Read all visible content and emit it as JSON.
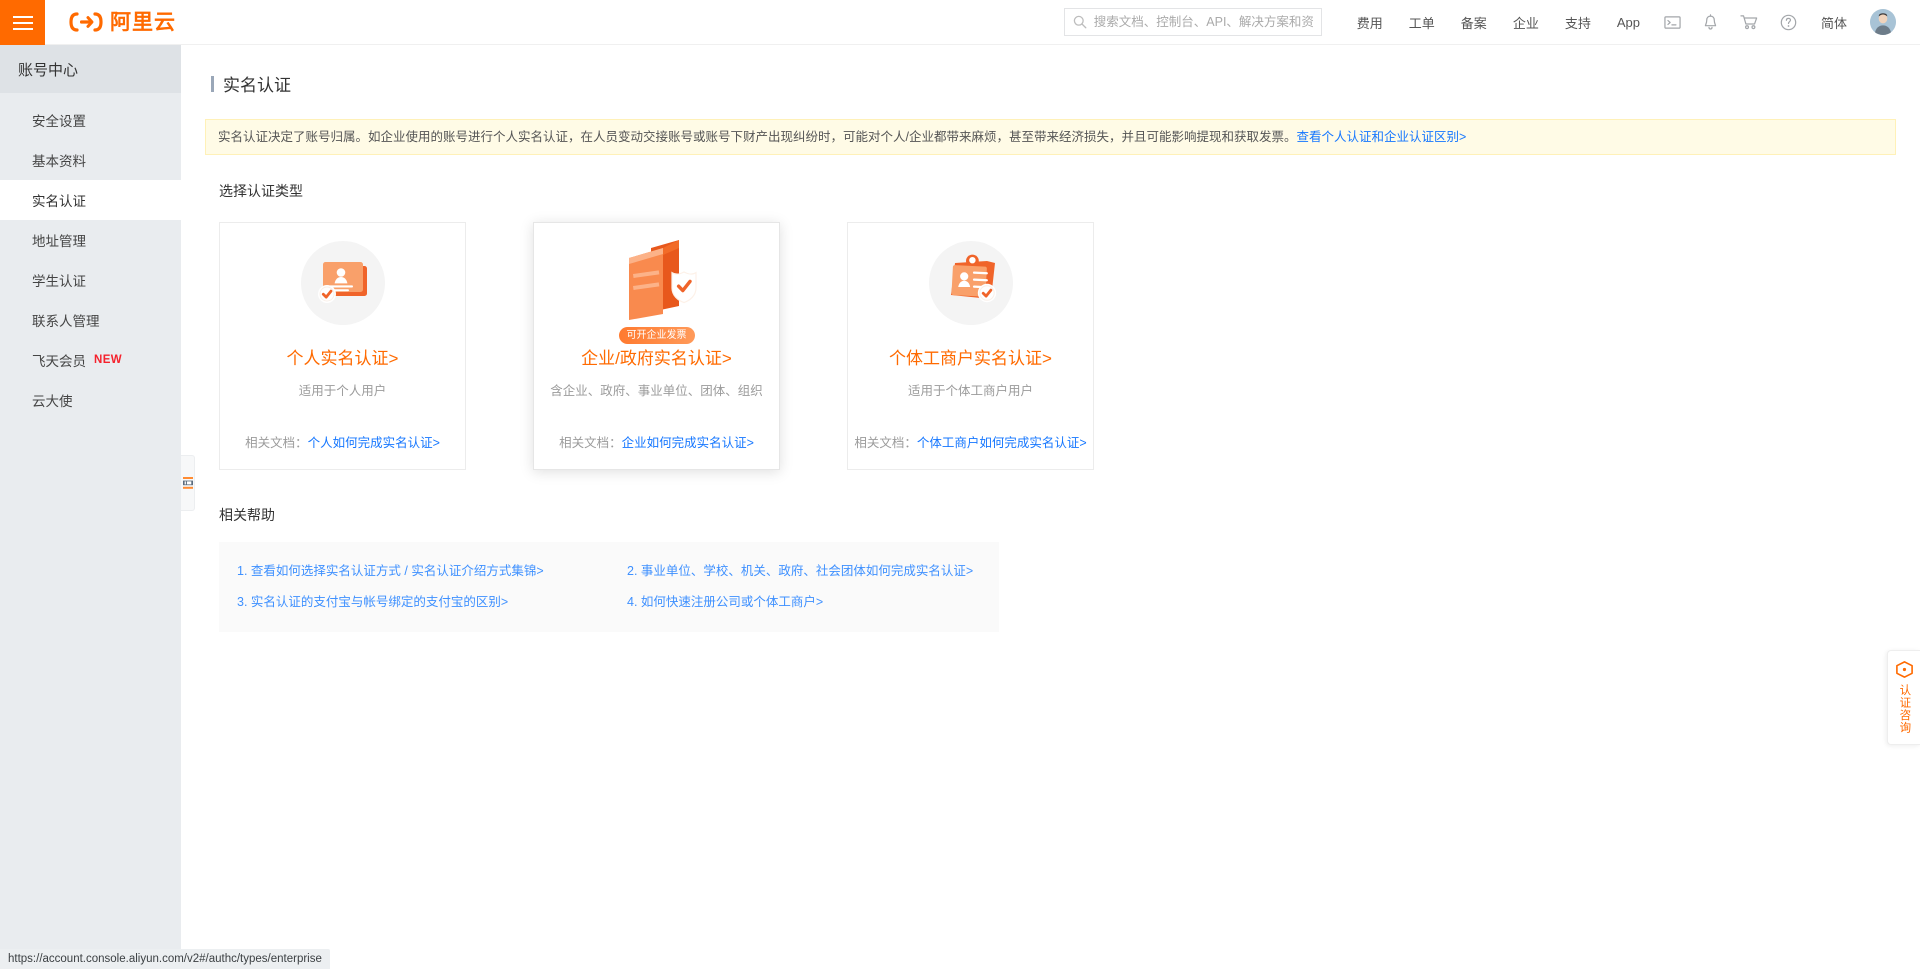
{
  "colors": {
    "brand_orange": "#ff6a00",
    "link_blue": "#1677ff",
    "help_blue": "#3e90ff",
    "sidebar_bg": "#e9ecef",
    "notice_bg": "#fffbe6",
    "notice_border": "#fff1b8",
    "badge_red": "#f5222d"
  },
  "topbar": {
    "menu_icon": "hamburger-icon",
    "logo_text": "阿里云",
    "logo_icon": "aliyun-logo-icon",
    "search": {
      "icon": "search-icon",
      "value": "",
      "placeholder": "搜索文档、控制台、API、解决方案和资"
    },
    "nav_items": [
      {
        "label": "费用"
      },
      {
        "label": "工单"
      },
      {
        "label": "备案"
      },
      {
        "label": "企业"
      },
      {
        "label": "支持"
      },
      {
        "label": "App"
      }
    ],
    "icons": [
      {
        "name": "terminal-icon"
      },
      {
        "name": "bell-icon"
      },
      {
        "name": "cart-icon"
      },
      {
        "name": "help-circle-icon"
      }
    ],
    "language_label": "简体",
    "avatar_name": "user-avatar"
  },
  "sidebar": {
    "title": "账号中心",
    "items": [
      {
        "label": "安全设置",
        "active": false,
        "badge": ""
      },
      {
        "label": "基本资料",
        "active": false,
        "badge": ""
      },
      {
        "label": "实名认证",
        "active": true,
        "badge": ""
      },
      {
        "label": "地址管理",
        "active": false,
        "badge": ""
      },
      {
        "label": "学生认证",
        "active": false,
        "badge": ""
      },
      {
        "label": "联系人管理",
        "active": false,
        "badge": ""
      },
      {
        "label": "飞天会员",
        "active": false,
        "badge": "NEW"
      },
      {
        "label": "云大使",
        "active": false,
        "badge": ""
      }
    ],
    "collapse_handle_icon": "collapse-sidebar-icon"
  },
  "main": {
    "page_title": "实名认证",
    "notice": {
      "text": "实名认证决定了账号归属。如企业使用的账号进行个人实名认证，在人员变动交接账号或账号下财产出现纠纷时，可能对个人/企业都带来麻烦，甚至带来经济损失，并且可能影响提现和获取发票。",
      "link": "查看个人认证和企业认证区别>"
    },
    "section_label": "选择认证类型",
    "cards": [
      {
        "art": "personal-id-cards-icon",
        "badge": "",
        "title": "个人实名认证>",
        "subtitle": "适用于个人用户",
        "doc_prefix": "相关文档：",
        "doc_link": "个人如何完成实名认证>",
        "raised": false
      },
      {
        "art": "enterprise-building-shield-icon",
        "badge": "可开企业发票",
        "title": "企业/政府实名认证>",
        "subtitle": "含企业、政府、事业单位、团体、组织",
        "doc_prefix": "相关文档：",
        "doc_link": "企业如何完成实名认证>",
        "raised": true
      },
      {
        "art": "business-license-badge-icon",
        "badge": "",
        "title": "个体工商户实名认证>",
        "subtitle": "适用于个体工商户用户",
        "doc_prefix": "相关文档：",
        "doc_link": "个体工商户如何完成实名认证>",
        "raised": false
      }
    ],
    "help_label": "相关帮助",
    "help_items": [
      "1. 查看如何选择实名认证方式 / 实名认证介绍方式集锦>",
      "2. 事业单位、学校、机关、政府、社会团体如何完成实名认证>",
      "3. 实名认证的支付宝与帐号绑定的支付宝的区别>",
      "4. 如何快速注册公司或个体工商户>"
    ]
  },
  "consult_widget": {
    "icon": "consult-chat-icon",
    "label": "认证咨询"
  },
  "statusbar": {
    "url": "https://account.console.aliyun.com/v2#/authc/types/enterprise"
  }
}
